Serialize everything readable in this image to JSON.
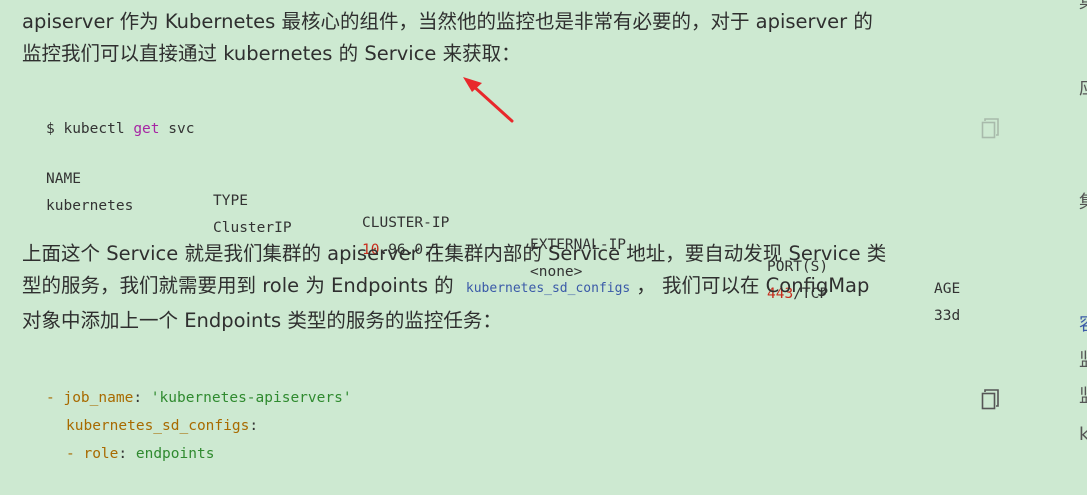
{
  "paragraph1": {
    "line1": "apiserver 作为 Kubernetes 最核心的组件，当然他的监控也是非常有必要的，对于 apiserver 的",
    "line2": "监控我们可以直接通过 kubernetes 的 Service 来获取："
  },
  "code1": {
    "command": {
      "prompt": "$ kubectl ",
      "kw": "get",
      "rest": " svc"
    },
    "headers": [
      "NAME",
      "TYPE",
      "CLUSTER-IP",
      "EXTERNAL-IP",
      "PORT(S)",
      "AGE"
    ],
    "row": {
      "name": "kubernetes",
      "type": "ClusterIP",
      "ip_hl": "10",
      "ip_rest": ".96.0.1",
      "external": "<none>",
      "port_hl": "443",
      "port_rest": "/TCP",
      "age": "33d"
    }
  },
  "paragraph2": {
    "line1": "上面这个 Service 就是我们集群的 apiserver 在集群内部的 Service 地址，要自动发现 Service 类",
    "line2_pre": "型的服务，我们就需要用到 role 为 Endpoints 的",
    "inline_code": "kubernetes_sd_configs",
    "line2_post": "， 我们可以在 ConfigMap",
    "line3": "对象中添加上一个 Endpoints 类型的服务的监控任务："
  },
  "code2": {
    "l1_dash": "- ",
    "l1_key": "job_name",
    "l1_colon": ": ",
    "l1_val": "'kubernetes-apiservers'",
    "l2_key": "kubernetes_sd_configs",
    "l2_colon": ":",
    "l3_dash": "- ",
    "l3_key": "role",
    "l3_colon": ": ",
    "l3_val": "endpoints"
  },
  "sidebar": {
    "g1": "集",
    "g2": "应",
    "g3": "集",
    "g4": "容",
    "g5": "监",
    "g6": "监",
    "g7": "k"
  },
  "colors": {
    "background": "#cde9d1",
    "arrow": "#e8282b",
    "keyword": "#a626a4",
    "number": "#c72e1e",
    "yaml_key": "#a86a00",
    "yaml_string": "#2f8a2f"
  }
}
